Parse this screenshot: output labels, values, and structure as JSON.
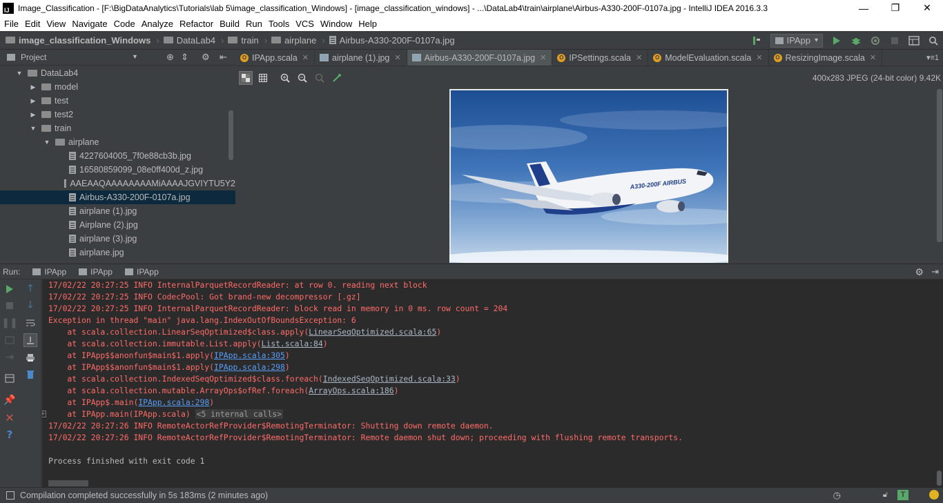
{
  "window": {
    "title": "Image_Classification - [F:\\BigDataAnalytics\\Tutorials\\lab 5\\image_classification_Windows] - [image_classification_windows] - ...\\DataLab4\\train\\airplane\\Airbus-A330-200F-0107a.jpg - IntelliJ IDEA 2016.3.3",
    "app_icon_text": "IJ",
    "minimize": "—",
    "maximize": "❐",
    "close": "✕"
  },
  "menu": [
    "File",
    "Edit",
    "View",
    "Navigate",
    "Code",
    "Analyze",
    "Refactor",
    "Build",
    "Run",
    "Tools",
    "VCS",
    "Window",
    "Help"
  ],
  "breadcrumbs": [
    "image_classification_Windows",
    "DataLab4",
    "train",
    "airplane",
    "Airbus-A330-200F-0107a.jpg"
  ],
  "run_config": {
    "label": "IPApp",
    "caret": "▾"
  },
  "project_panel": {
    "title": "Project",
    "tree": [
      {
        "label": "DataLab4",
        "type": "folder",
        "arrow": "▼",
        "depth": 1
      },
      {
        "label": "model",
        "type": "folder",
        "arrow": "▶",
        "depth": 2
      },
      {
        "label": "test",
        "type": "folder",
        "arrow": "▶",
        "depth": 2
      },
      {
        "label": "test2",
        "type": "folder",
        "arrow": "▶",
        "depth": 2
      },
      {
        "label": "train",
        "type": "folder",
        "arrow": "▼",
        "depth": 2
      },
      {
        "label": "airplane",
        "type": "folder",
        "arrow": "▼",
        "depth": 3
      },
      {
        "label": "4227604005_7f0e88cb3b.jpg",
        "type": "file",
        "depth": 4
      },
      {
        "label": "16580859099_08e0ff400d_z.jpg",
        "type": "file",
        "depth": 4
      },
      {
        "label": "AAEAAQAAAAAAAAMiAAAAJGVIYTU5Y2",
        "type": "file",
        "depth": 4
      },
      {
        "label": "Airbus-A330-200F-0107a.jpg",
        "type": "file",
        "depth": 4,
        "selected": true
      },
      {
        "label": "airplane (1).jpg",
        "type": "file",
        "depth": 4
      },
      {
        "label": "Airplane (2).jpg",
        "type": "file",
        "depth": 4
      },
      {
        "label": "airplane (3).jpg",
        "type": "file",
        "depth": 4
      },
      {
        "label": "airplane.jpg",
        "type": "file",
        "depth": 4
      }
    ]
  },
  "editor_tabs": [
    {
      "label": "IPApp.scala",
      "kind": "scala"
    },
    {
      "label": "airplane (1).jpg",
      "kind": "image"
    },
    {
      "label": "Airbus-A330-200F-0107a.jpg",
      "kind": "image",
      "active": true
    },
    {
      "label": "IPSettings.scala",
      "kind": "scala"
    },
    {
      "label": "ModelEvaluation.scala",
      "kind": "scala"
    },
    {
      "label": "ResizingImage.scala",
      "kind": "scala"
    }
  ],
  "tab_overflow": "▾≡1",
  "image_info": "400x283 JPEG (24-bit color) 9.42K",
  "airplane_livery": "A330-200F AIRBUS",
  "run_panel": {
    "label": "Run:",
    "tabs": [
      "IPApp",
      "IPApp",
      "IPApp"
    ]
  },
  "console": {
    "lines": [
      {
        "text": "17/02/22 20:27:25 INFO InternalParquetRecordReader: at row 0. reading next block",
        "style": "err"
      },
      {
        "text": "17/02/22 20:27:25 INFO CodecPool: Got brand-new decompressor [.gz]",
        "style": "err"
      },
      {
        "text": "17/02/22 20:27:25 INFO InternalParquetRecordReader: block read in memory in 0 ms. row count = 204",
        "style": "err"
      },
      {
        "text": "Exception in thread \"main\" java.lang.IndexOutOfBoundsException: 6",
        "style": "err"
      }
    ],
    "stack": [
      {
        "prefix": "    at scala.collection.LinearSeqOptimized$class.apply(",
        "link": "LinearSeqOptimized.scala:65",
        "link_style": "grey",
        "suffix": ")"
      },
      {
        "prefix": "    at scala.collection.immutable.List.apply(",
        "link": "List.scala:84",
        "link_style": "grey",
        "suffix": ")"
      },
      {
        "prefix": "    at IPApp$$anonfun$main$1.apply(",
        "link": "IPApp.scala:305",
        "link_style": "blue",
        "suffix": ")"
      },
      {
        "prefix": "    at IPApp$$anonfun$main$1.apply(",
        "link": "IPApp.scala:298",
        "link_style": "blue",
        "suffix": ")"
      },
      {
        "prefix": "    at scala.collection.IndexedSeqOptimized$class.foreach(",
        "link": "IndexedSeqOptimized.scala:33",
        "link_style": "grey",
        "suffix": ")"
      },
      {
        "prefix": "    at scala.collection.mutable.ArrayOps$ofRef.foreach(",
        "link": "ArrayOps.scala:186",
        "link_style": "grey",
        "suffix": ")"
      },
      {
        "prefix": "    at IPApp$.main(",
        "link": "IPApp.scala:298",
        "link_style": "blue",
        "suffix": ")"
      }
    ],
    "internal_line": {
      "prefix": "    at IPApp.main(IPApp.scala) ",
      "badge": "<5 internal calls>",
      "expander": "+"
    },
    "tail_lines": [
      {
        "text": "17/02/22 20:27:26 INFO RemoteActorRefProvider$RemotingTerminator: Shutting down remote daemon.",
        "style": "err"
      },
      {
        "text": "17/02/22 20:27:26 INFO RemoteActorRefProvider$RemotingTerminator: Remote daemon shut down; proceeding with flushing remote transports.",
        "style": "err"
      }
    ],
    "exit_line": "Process finished with exit code 1"
  },
  "status": {
    "message": "Compilation completed successfully in 5s 183ms (2 minutes ago)",
    "indicator_t": "T"
  },
  "colors": {
    "error_text": "#ff6b68",
    "link": "#589df6",
    "selection": "#0d293e",
    "scala_icon": "#e19e21",
    "run_green": "#59a869"
  }
}
